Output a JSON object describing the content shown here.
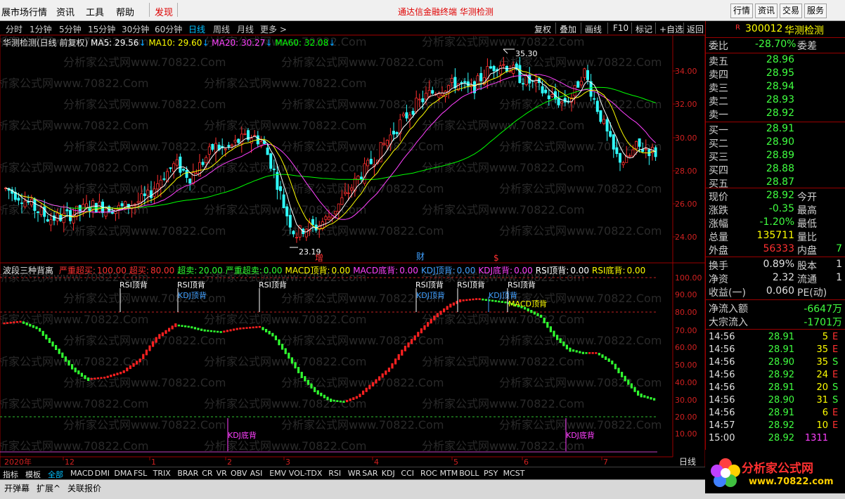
{
  "menu": {
    "items": [
      "展市场行情",
      "资讯",
      "工具",
      "帮助"
    ],
    "active": "发现",
    "center_text": "通达信金融终端   华测检测",
    "right_buttons": [
      "行情",
      "资讯",
      "交易",
      "服务"
    ]
  },
  "periods": [
    "分时",
    "1分钟",
    "5分钟",
    "15分钟",
    "30分钟",
    "60分钟",
    "日线",
    "周线",
    "月线",
    "更多 >"
  ],
  "active_period": "日线",
  "tools": [
    "复权",
    "叠加",
    "画线",
    "F10",
    "标记",
    "+自选",
    "返回"
  ],
  "main_title": {
    "name": "华测检测(日线 前复权)",
    "ma5": "MA5: 29.56",
    "ma10": "MA10: 29.60",
    "ma20": "MA20: 30.27",
    "ma60": "MA60: 32.08"
  },
  "price_axis": [
    "34.00",
    "32.00",
    "30.00",
    "28.00",
    "26.00",
    "24.00"
  ],
  "price_marks": {
    "high": "35.30",
    "low": "23.19"
  },
  "event_marks": [
    "增",
    "财",
    "$"
  ],
  "indicator_title": {
    "name": "波段三种背离",
    "items": [
      {
        "label": "严重超买:",
        "value": "100.00",
        "color": "#ff3030"
      },
      {
        "label": "超买:",
        "value": "80.00",
        "color": "#ff3030"
      },
      {
        "label": "超卖:",
        "value": "20.00",
        "color": "#30ff30"
      },
      {
        "label": "严重超卖:",
        "value": "0.00",
        "color": "#30ff30"
      },
      {
        "label": "MACD顶背:",
        "value": "0.00",
        "color": "#ffff00"
      },
      {
        "label": "MACD底背:",
        "value": "0.00",
        "color": "#ff40ff"
      },
      {
        "label": "KDJ顶背:",
        "value": "0.00",
        "color": "#40a0ff"
      },
      {
        "label": "KDJ底背:",
        "value": "0.00",
        "color": "#ff40ff"
      },
      {
        "label": "RSI顶背:",
        "value": "0.00",
        "color": "#ffffff"
      },
      {
        "label": "RSI底背:",
        "value": "0.00",
        "color": "#ffff00"
      }
    ]
  },
  "ind_axis": [
    "100.00",
    "90.00",
    "80.00",
    "70.00",
    "60.00",
    "50.00",
    "40.00",
    "30.00",
    "20.00",
    "10.00"
  ],
  "signal_labels": {
    "rsi": "RSI顶背",
    "kdj_top": "KDJ顶背",
    "macd_top": "MACD顶背",
    "kdj_bottom": "KDJ底背"
  },
  "x_axis": [
    "2020年",
    "12",
    "1",
    "2",
    "3",
    "4",
    "5",
    "6",
    "7"
  ],
  "watermark": "分析家公式网www.70822.Com",
  "stock": {
    "code": "300012",
    "name": "华测检测",
    "badge": "R"
  },
  "order_book": {
    "weibi_label": "委比",
    "weibi": "-28.70%",
    "weicha_label": "委差",
    "sells": [
      {
        "label": "卖五",
        "price": "28.96"
      },
      {
        "label": "卖四",
        "price": "28.95"
      },
      {
        "label": "卖三",
        "price": "28.94"
      },
      {
        "label": "卖二",
        "price": "28.93"
      },
      {
        "label": "卖一",
        "price": "28.92"
      }
    ],
    "buys": [
      {
        "label": "买一",
        "price": "28.91"
      },
      {
        "label": "买二",
        "price": "28.90"
      },
      {
        "label": "买三",
        "price": "28.89"
      },
      {
        "label": "买四",
        "price": "28.88"
      },
      {
        "label": "买五",
        "price": "28.87"
      }
    ]
  },
  "quote": [
    {
      "l1": "现价",
      "v1": "28.92",
      "c1": "#40ff40",
      "l2": "今开"
    },
    {
      "l1": "涨跌",
      "v1": "-0.35",
      "c1": "#40ff40",
      "l2": "最高"
    },
    {
      "l1": "涨幅",
      "v1": "-1.20%",
      "c1": "#40ff40",
      "l2": "最低"
    },
    {
      "l1": "总量",
      "v1": "135711",
      "c1": "#ffff00",
      "l2": "量比"
    },
    {
      "l1": "外盘",
      "v1": "56333",
      "c1": "#ff3030",
      "l2": "内盘",
      "v2": "7",
      "c2": "#40ff40"
    }
  ],
  "fundamentals": [
    {
      "l1": "换手",
      "v1": "0.89%",
      "l2": "股本",
      "v2": "1"
    },
    {
      "l1": "净资",
      "v1": "2.32",
      "l2": "流通",
      "v2": "1"
    },
    {
      "l1": "收益(一)",
      "v1": "0.060",
      "l2": "PE(动)",
      "v2": ""
    }
  ],
  "flows": [
    {
      "label": "净流入额",
      "value": "-6647万"
    },
    {
      "label": "大宗流入",
      "value": "-1701万"
    }
  ],
  "ticks": [
    {
      "time": "14:56",
      "price": "28.91",
      "vol": "5",
      "flag": "E",
      "fc": "#ff3030"
    },
    {
      "time": "14:56",
      "price": "28.91",
      "vol": "35",
      "flag": "E",
      "fc": "#ff3030"
    },
    {
      "time": "14:56",
      "price": "28.90",
      "vol": "35",
      "flag": "S",
      "fc": "#40ff40"
    },
    {
      "time": "14:56",
      "price": "28.92",
      "vol": "24",
      "flag": "E",
      "fc": "#ff3030"
    },
    {
      "time": "14:56",
      "price": "28.91",
      "vol": "20",
      "flag": "S",
      "fc": "#40ff40"
    },
    {
      "time": "14:56",
      "price": "28.90",
      "vol": "31",
      "flag": "S",
      "fc": "#40ff40"
    },
    {
      "time": "14:56",
      "price": "28.91",
      "vol": "6",
      "flag": "E",
      "fc": "#ff3030"
    },
    {
      "time": "14:57",
      "price": "28.92",
      "vol": "10",
      "flag": "E",
      "fc": "#ff3030"
    },
    {
      "time": "15:00",
      "price": "28.92",
      "vol": "1311",
      "flag": "",
      "fc": "#ff40ff"
    }
  ],
  "day_label": "日线",
  "indicator_tabs": [
    "指标",
    "模板",
    "全部",
    "MACD",
    "DMI",
    "DMA",
    "FSL",
    "TRIX",
    "BRAR",
    "CR",
    "VR",
    "OBV",
    "ASI",
    "EMV",
    "VOL-TDX",
    "RSI",
    "WR",
    "SAR",
    "KDJ",
    "CCI",
    "ROC",
    "MTM",
    "BOLL",
    "PSY",
    "MCST"
  ],
  "bottom_tabs": [
    "开弹幕",
    "扩展^",
    "关联报价"
  ],
  "logo": {
    "title": "分析家公式网",
    "url": "www.70822.com"
  },
  "colors": {
    "up": "#ff3030",
    "down": "#30ffff",
    "ma5": "#ffffff",
    "ma10": "#ffff00",
    "ma20": "#ff40ff",
    "ma60": "#00ff00",
    "axis": "#9a0000"
  }
}
